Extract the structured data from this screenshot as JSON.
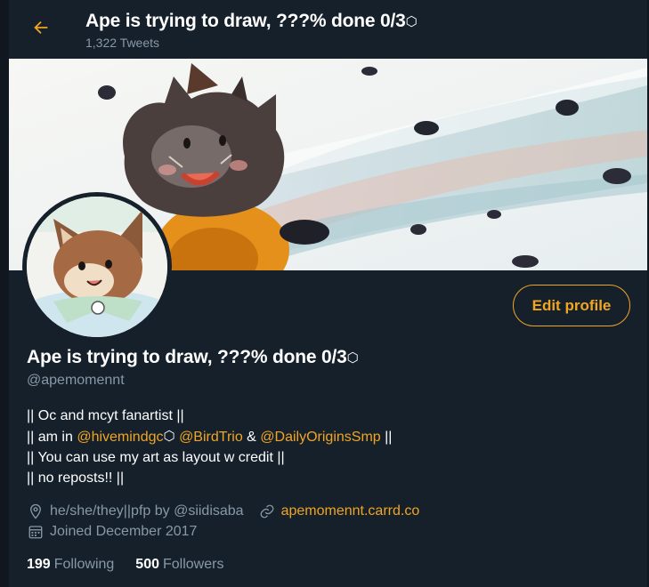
{
  "header": {
    "title": "Ape is trying to draw, ???% done 0/3",
    "title_emoji": "⬡",
    "tweet_count": "1,322 Tweets"
  },
  "profile": {
    "display_name": "Ape is trying to draw, ???% done 0/3",
    "display_name_emoji": "⬡",
    "handle": "@apemomennt",
    "edit_button": "Edit profile"
  },
  "bio": {
    "line1": "|| Oc and mcyt fanartist ||",
    "line2_prefix": "|| am in ",
    "line2_link1": "@hivemindgc",
    "line2_link1_emoji": "⬡",
    "line2_link2": "@BirdTrio",
    "line2_amp": " & ",
    "line2_link3": "@DailyOriginsSmp",
    "line2_suffix": " ||",
    "line3": "|| You can use my art as layout w credit ||",
    "line4": "|| no reposts!! ||"
  },
  "meta": {
    "location": "he/she/they||pfp by @siidisaba",
    "website": "apemomennt.carrd.co",
    "joined": "Joined December 2017"
  },
  "stats": {
    "following_count": "199",
    "following_label": "Following",
    "followers_count": "500",
    "followers_label": "Followers"
  },
  "icons": {
    "back": "arrow-left-icon",
    "location": "location-pin-icon",
    "website": "link-icon",
    "joined": "calendar-icon"
  },
  "colors": {
    "background": "#15202b",
    "accent": "#f0a523",
    "secondary_text": "#8899a6",
    "primary_text": "#ffffff"
  }
}
